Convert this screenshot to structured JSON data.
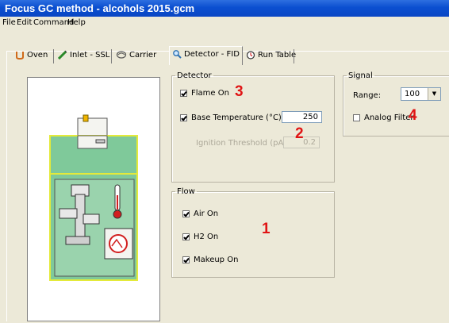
{
  "window": {
    "title": "Focus GC method - alcohols 2015.gcm"
  },
  "menu": [
    "File",
    "Edit",
    "Command",
    "Help"
  ],
  "tabs": [
    {
      "label": "Oven",
      "icon": "oven-icon"
    },
    {
      "label": "Inlet - SSL",
      "icon": "syringe-icon"
    },
    {
      "label": "Carrier",
      "icon": "carrier-gas-icon"
    },
    {
      "label": "Detector - FID",
      "icon": "magnifier-icon",
      "active": true
    },
    {
      "label": "Run Table",
      "icon": "stopwatch-icon"
    }
  ],
  "detector": {
    "legend": "Detector",
    "flame_on_label": "Flame On",
    "flame_on_checked": true,
    "base_temp_label": "Base Temperature (°C):",
    "base_temp_checked": true,
    "base_temp_value": "250",
    "ignition_label": "Ignition Threshold (pA):",
    "ignition_value": "0.2"
  },
  "signal": {
    "legend": "Signal",
    "range_label": "Range:",
    "range_value": "100",
    "analog_filter_label": "Analog Filter",
    "analog_filter_checked": false
  },
  "flow": {
    "legend": "Flow",
    "items": [
      {
        "label": "Air On",
        "checked": true
      },
      {
        "label": "H2 On",
        "checked": true
      },
      {
        "label": "Makeup On",
        "checked": true
      }
    ]
  },
  "annotations": [
    "1",
    "2",
    "3",
    "4"
  ],
  "colors": {
    "titlebar": "#0a4fd2",
    "annotation": "#e01414",
    "illustration_green": "#7fc99a",
    "illustration_border": "#e4ea3a"
  }
}
